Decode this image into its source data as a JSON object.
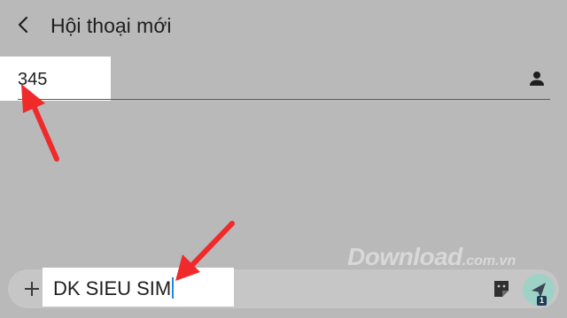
{
  "header": {
    "title": "Hội thoại mới",
    "back_icon": "arrow-left-icon"
  },
  "recipient": {
    "value": "345",
    "contact_icon": "person-icon"
  },
  "composer": {
    "attach_icon": "plus-icon",
    "message_text": "DK SIEU SIM",
    "sticker_icon": "sticker-icon",
    "send_icon": "send-icon",
    "send_badge": "1",
    "send_color": "#9fd2c6"
  },
  "watermark": {
    "main": "Download",
    "sub": ".com.vn",
    "dot_colors": [
      "#4fb8e6",
      "#d0d0d0",
      "#8cc152",
      "#f0b429",
      "#d64545"
    ]
  },
  "annotations": {
    "arrow_color": "#f02a2a"
  }
}
